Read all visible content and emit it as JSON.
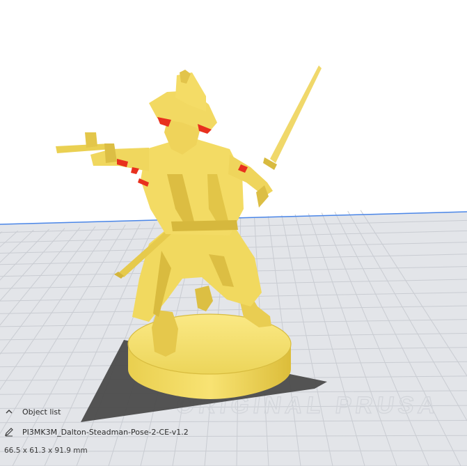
{
  "object_list": {
    "label": "Object list"
  },
  "object": {
    "name": "PI3MK3M_Dalton-Steadman-Pose-2-CE-v1.2",
    "dimensions": "66.5 x 61.3 x 91.9 mm"
  },
  "watermark": {
    "text": "ORIGINAL PRUSA"
  },
  "colors": {
    "model": "#f5e06a",
    "model_shadow": "#d8b836",
    "overhang": "#e8301e",
    "bed": "#e4e6ea",
    "grid": "#c6c9cf",
    "bed_edge": "#4a86e8",
    "shadow": "#4b4b4b"
  }
}
